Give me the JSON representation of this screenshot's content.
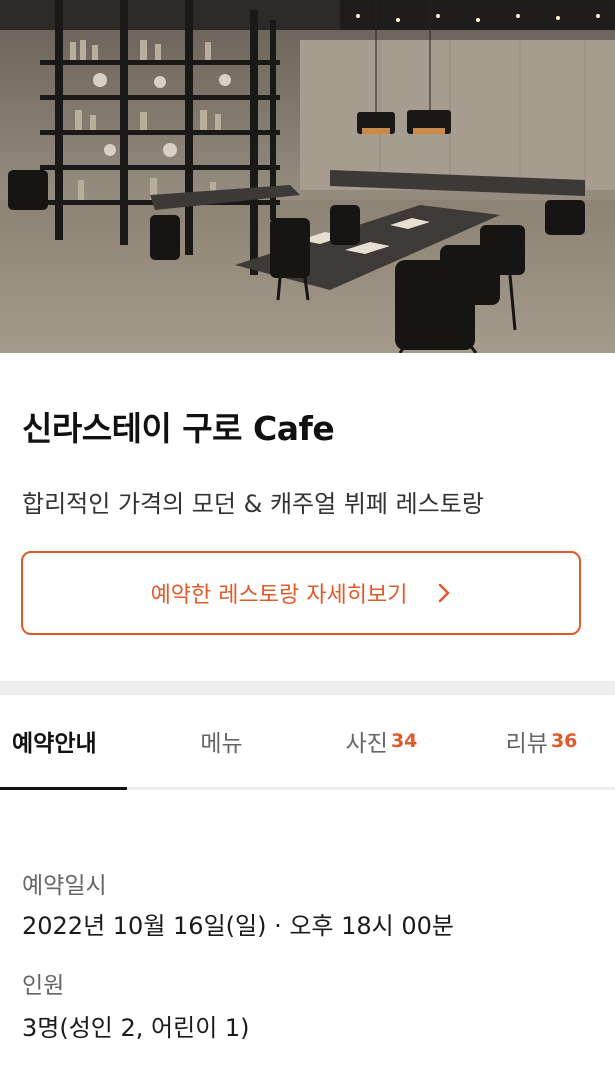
{
  "colors": {
    "accent": "#e2592a",
    "divider": "#eeeeee"
  },
  "hero": {
    "image": "restaurant-interior-photo"
  },
  "restaurant": {
    "name": "신라스테이 구로 Cafe",
    "description": "합리적인 가격의 모던 & 캐주얼 뷔페 레스토랑",
    "detail_button": "예약한 레스토랑 자세히보기",
    "detail_icon": "chevron-right-icon"
  },
  "tabs": [
    {
      "label": "예약안내",
      "count": "",
      "active": true
    },
    {
      "label": "메뉴",
      "count": "",
      "active": false
    },
    {
      "label": "사진",
      "count": "34",
      "active": false
    },
    {
      "label": "리뷰",
      "count": "36",
      "active": false
    }
  ],
  "reservation": {
    "date_label": "예약일시",
    "date_value": "2022년 10월 16일(일) · 오후 18시 00분",
    "party_label": "인원",
    "party_value": "3명(성인 2, 어린이 1)"
  }
}
